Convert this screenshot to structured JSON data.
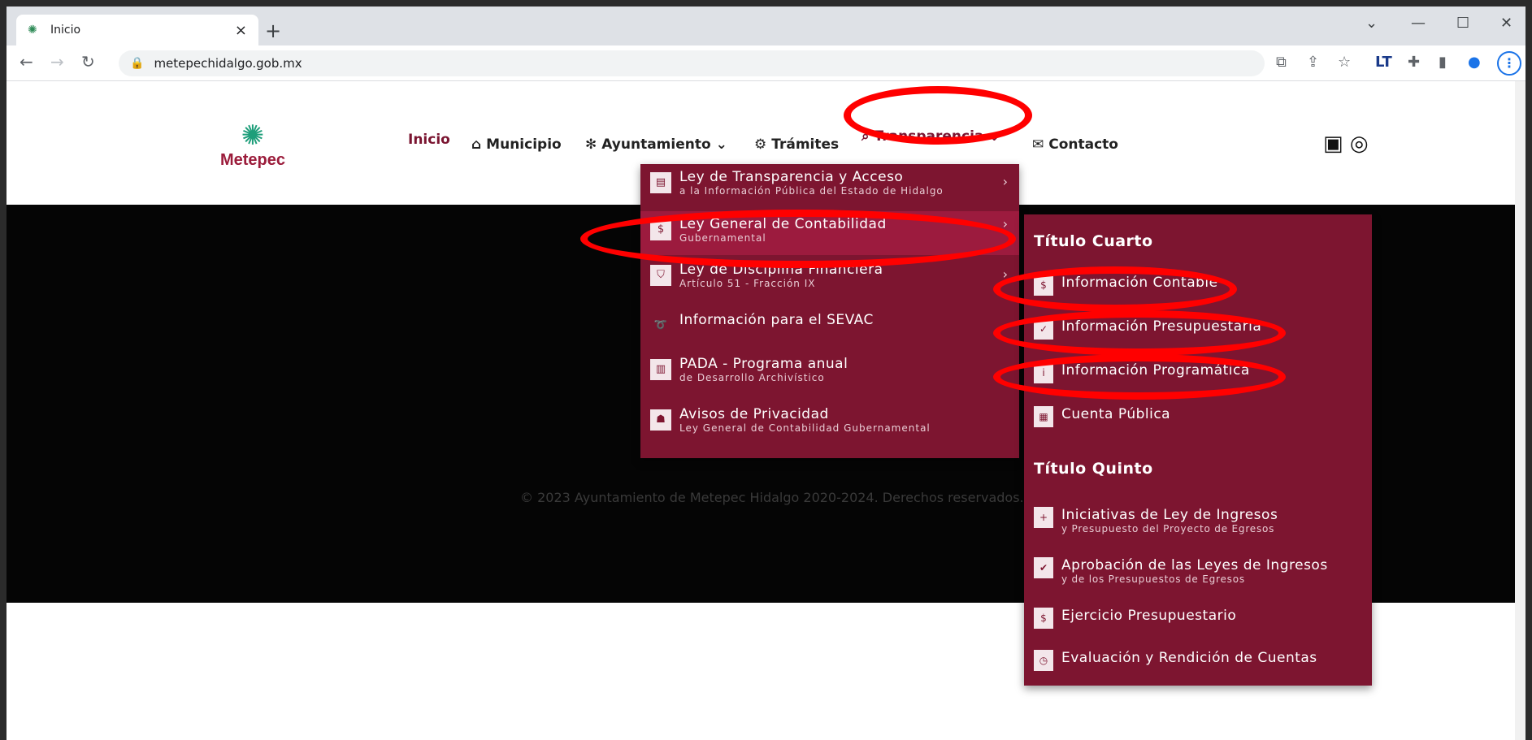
{
  "browser": {
    "tab_title": "Inicio",
    "tab_close": "×",
    "new_tab": "+",
    "url": "metepechidalgo.gob.mx",
    "icons": [
      "back-icon",
      "forward-icon",
      "reload-icon",
      "lock-icon",
      "translate-icon",
      "share-icon",
      "star-icon",
      "extension-lt-icon",
      "puzzle-icon",
      "sidepanel-icon",
      "profile-icon",
      "menu-icon"
    ]
  },
  "header": {
    "logo_text": "Metepec",
    "nav": {
      "inicio": "Inicio",
      "municipio": "Municipio",
      "ayuntamiento": "Ayuntamiento",
      "tramites": "Trámites",
      "transparencia": "Transparencia",
      "contacto": "Contacto"
    }
  },
  "transparencia_menu": [
    {
      "title": "Ley de Transparencia y Acceso",
      "subtitle": "a la Información Pública del Estado de Hidalgo"
    },
    {
      "title": "Ley General de Contabilidad",
      "subtitle": "Gubernamental"
    },
    {
      "title": "Ley de Disciplina Financiera",
      "subtitle": "Artículo 51 - Fracción IX"
    },
    {
      "title": "Información para el SEVAC",
      "subtitle": ""
    },
    {
      "title": "PADA - Programa anual",
      "subtitle": "de Desarrollo Archivístico"
    },
    {
      "title": "Avisos de Privacidad",
      "subtitle": "Ley General de Contabilidad Gubernamental"
    }
  ],
  "contabilidad_submenu": {
    "heading_1": "Título Cuarto",
    "items_1": [
      {
        "title": "Información Contable"
      },
      {
        "title": "Información Presupuestaria"
      },
      {
        "title": "Información Programática"
      },
      {
        "title": "Cuenta Pública"
      }
    ],
    "heading_2": "Título Quinto",
    "items_2": [
      {
        "title": "Iniciativas de Ley de Ingresos",
        "subtitle": "y Presupuesto del Proyecto de Egresos"
      },
      {
        "title": "Aprobación de las Leyes de Ingresos",
        "subtitle": "y de los Presupuestos de Egresos"
      },
      {
        "title": "Ejercicio Presupuestario",
        "subtitle": ""
      },
      {
        "title": "Evaluación y Rendición de Cuentas",
        "subtitle": ""
      }
    ]
  },
  "footer": {
    "copyright": "© 2023 Ayuntamiento de Metepec Hidalgo 2020-2024. Derechos reservados."
  },
  "colors": {
    "brand": "#7d1530",
    "active": "#9c1b3e",
    "annotation": "#ff0000"
  }
}
